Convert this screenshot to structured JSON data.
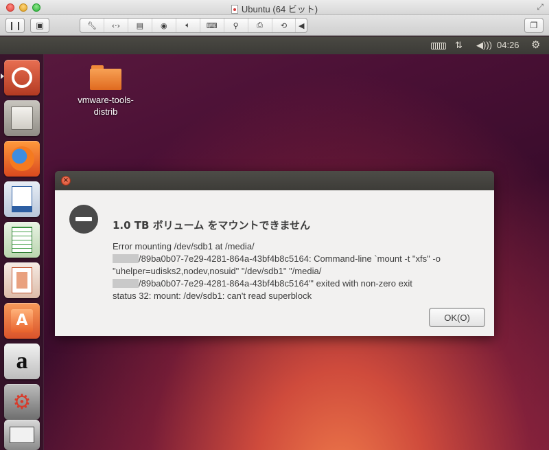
{
  "window": {
    "title": "Ubuntu (64 ビット)"
  },
  "toolbar": {
    "pause_icon": "pause-icon",
    "snapshot_icon": "snapshot-icon",
    "device_icons": [
      "wrench-icon",
      "network-icon",
      "harddisk-icon",
      "cdrom-icon",
      "sound-icon",
      "mouse-icon",
      "usb-icon",
      "printer-icon",
      "shared-folders-icon",
      "collapse-arrow-icon"
    ],
    "window_icon": "window-mode-icon"
  },
  "panel": {
    "indicators": [
      "keyboard-icon",
      "network-arrows-icon",
      "volume-icon",
      "gear-icon"
    ],
    "clock": "04:26"
  },
  "launcher": {
    "apps": [
      "Ubuntu Dash",
      "Files",
      "Firefox",
      "LibreOffice Writer",
      "LibreOffice Calc",
      "LibreOffice Impress",
      "Ubuntu Software Center",
      "Amazon",
      "System Settings",
      "Scanner"
    ]
  },
  "desktop": {
    "icon_label_line1": "vmware-tools-",
    "icon_label_line2": "distrib"
  },
  "dialog": {
    "heading": "1.0 TB ボリューム をマウントできません",
    "msg_1": "Error mounting /dev/sdb1 at /media/",
    "msg_2": "/89ba0b07-7e29-4281-864a-43bf4b8c5164: Command-line `mount -t \"xfs\" -o",
    "msg_3": "\"uhelper=udisks2,nodev,nosuid\" \"/dev/sdb1\" \"/media/",
    "msg_4": "/89ba0b07-7e29-4281-864a-43bf4b8c5164\"' exited with non-zero exit",
    "msg_5": "status 32: mount: /dev/sdb1: can't read superblock",
    "ok_label": "OK(O)"
  },
  "colors": {
    "accent": "#e95420",
    "panel": "#3c3b37",
    "dialog_bg": "#f2f1f0"
  }
}
